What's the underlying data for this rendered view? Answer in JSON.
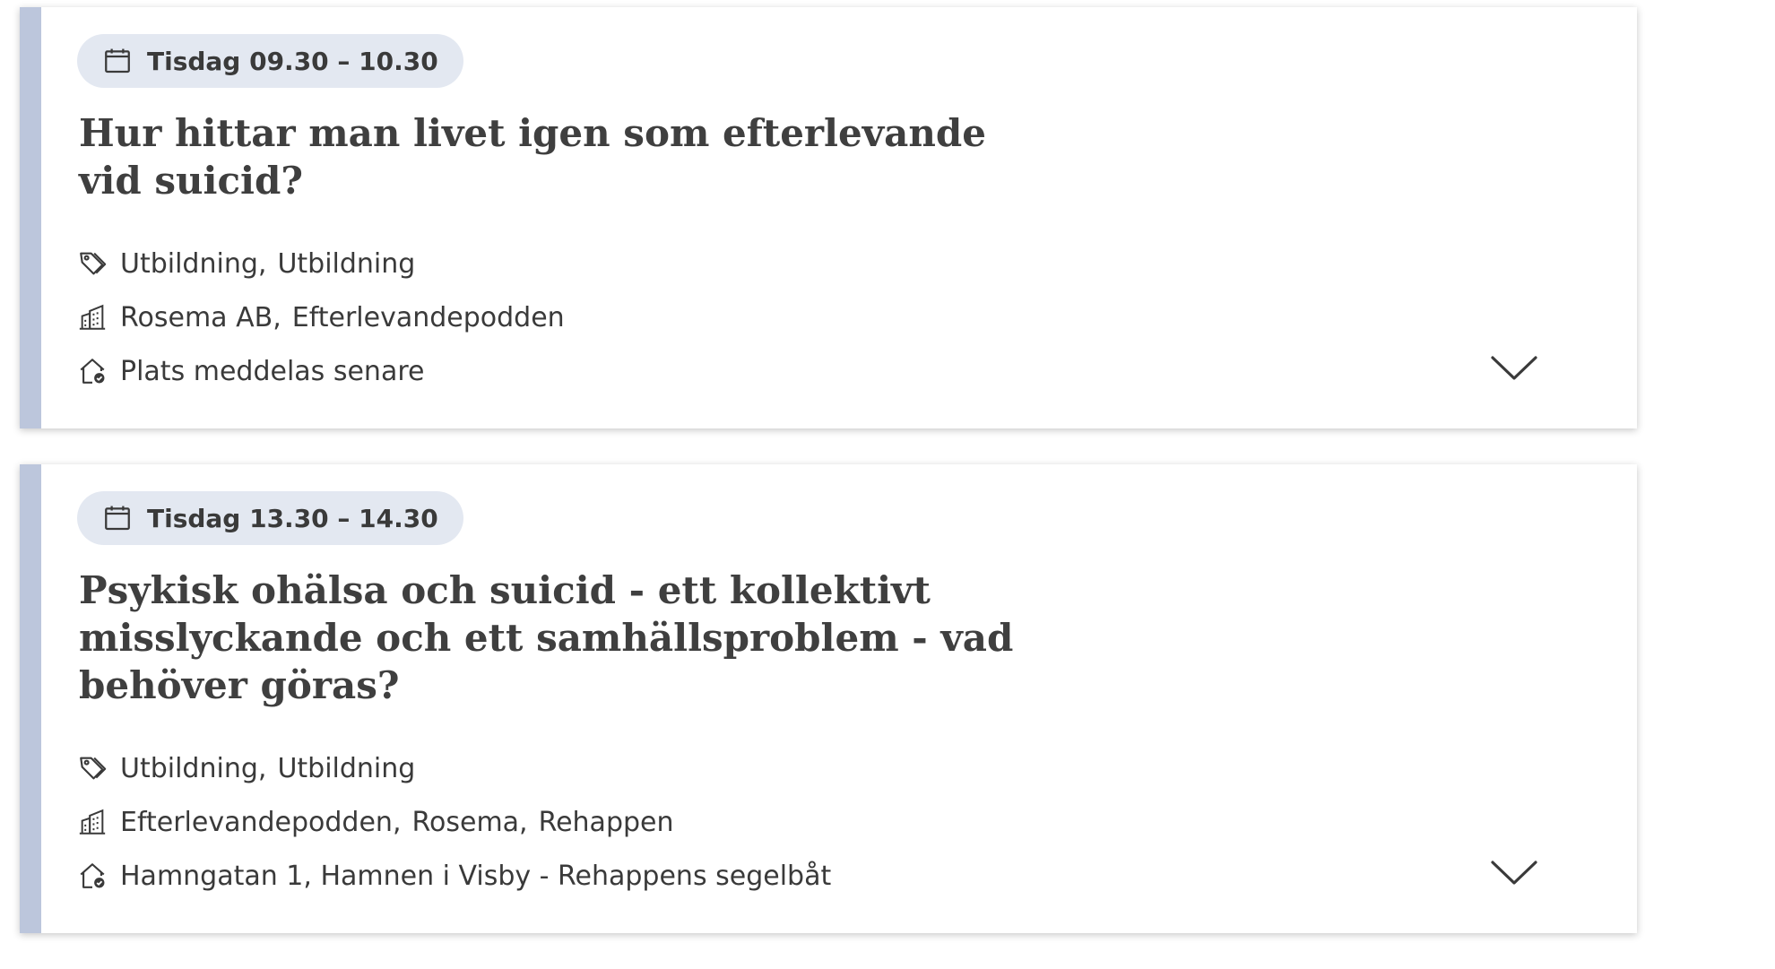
{
  "events": [
    {
      "time": "Tisdag 09.30 – 10.30",
      "title": "Hur hittar man livet igen som efterlevande vid suicid?",
      "categories": [
        "Utbildning",
        "Utbildning"
      ],
      "organizers": [
        "Rosema AB",
        "Efterlevandepodden"
      ],
      "location": "Plats meddelas senare"
    },
    {
      "time": "Tisdag 13.30 – 14.30",
      "title": "Psykisk ohälsa och suicid - ett kollektivt misslyckande och ett samhällsproblem - vad behöver göras?",
      "categories": [
        "Utbildning",
        "Utbildning"
      ],
      "organizers": [
        "Efterlevandepodden",
        "Rosema",
        "Rehappen"
      ],
      "location": "Hamngatan 1, Hamnen i Visby - Rehappens segelbåt"
    }
  ],
  "icons": {
    "time": "calendar-icon",
    "categories": "tag-icon",
    "organizers": "building-icon",
    "location": "home-location-icon",
    "expand": "chevron-down-icon"
  },
  "colors": {
    "accent_bar": "#bcc6dc",
    "badge_bg": "#e3e8f1",
    "text": "#3d3d3d"
  }
}
